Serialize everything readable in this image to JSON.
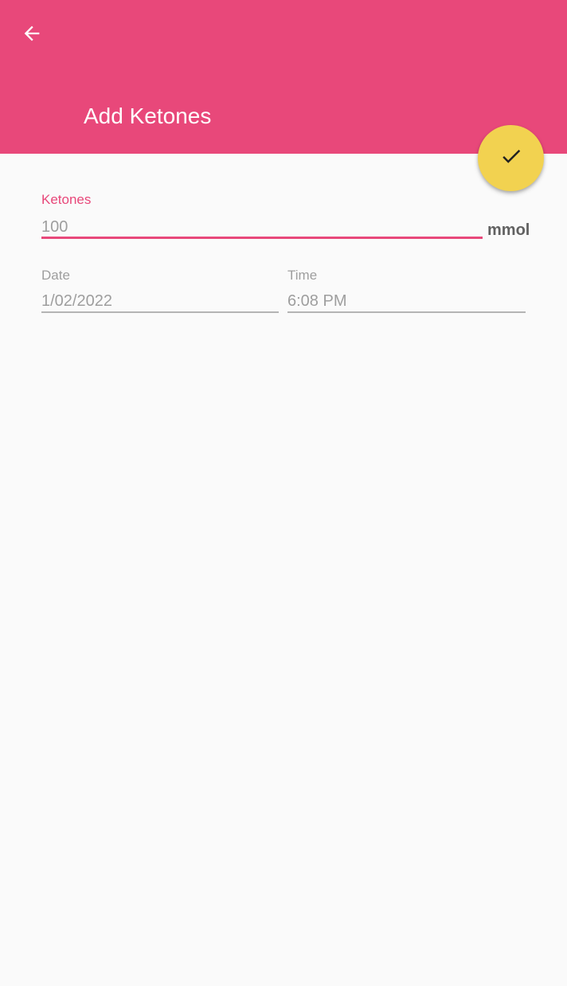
{
  "header": {
    "title": "Add Ketones",
    "back_icon": "arrow-left-icon",
    "confirm_icon": "check-icon"
  },
  "colors": {
    "primary": "#e8487a",
    "fab": "#f2d250",
    "background": "#fafafa"
  },
  "form": {
    "ketones": {
      "label": "Ketones",
      "value": "100",
      "unit": "mmol"
    },
    "date": {
      "label": "Date",
      "value": "1/02/2022"
    },
    "time": {
      "label": "Time",
      "value": "6:08 PM"
    }
  }
}
